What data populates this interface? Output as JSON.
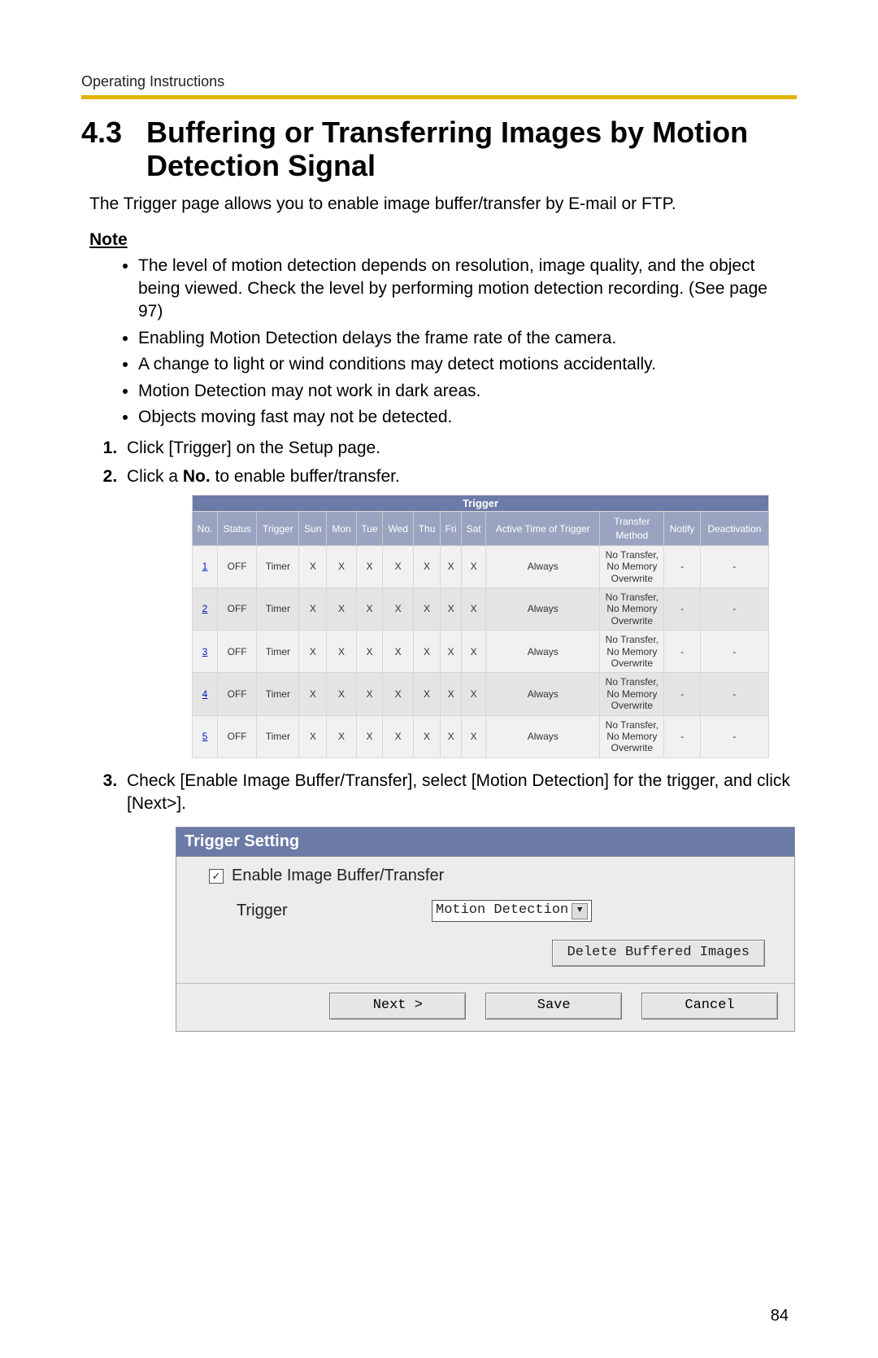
{
  "header": {
    "running": "Operating Instructions"
  },
  "section": {
    "number": "4.3",
    "title": "Buffering or Transferring Images by Motion Detection Signal",
    "intro": "The Trigger page allows you to enable image buffer/transfer by E-mail or FTP."
  },
  "note": {
    "heading": "Note",
    "items": [
      "The level of motion detection depends on resolution, image quality, and the object being viewed. Check the level by performing motion detection recording. (See page 97)",
      "Enabling Motion Detection delays the frame rate of the camera.",
      "A change to light or wind conditions may detect motions accidentally.",
      "Motion Detection may not work in dark areas.",
      "Objects moving fast may not be detected."
    ]
  },
  "steps": {
    "s1": "Click [Trigger] on the Setup page.",
    "s2_pre": "Click a ",
    "s2_bold": "No.",
    "s2_post": " to enable buffer/transfer.",
    "s3": "Check [Enable Image Buffer/Transfer], select [Motion Detection] for the trigger, and click [Next>]."
  },
  "trigger_table": {
    "title": "Trigger",
    "headers": [
      "No.",
      "Status",
      "Trigger",
      "Sun",
      "Mon",
      "Tue",
      "Wed",
      "Thu",
      "Fri",
      "Sat",
      "Active Time of Trigger",
      "Transfer Method",
      "Notify",
      "Deactivation"
    ],
    "transfer_text": "No Transfer, No Memory Overwrite",
    "rows": [
      {
        "no": "1",
        "status": "OFF",
        "trigger": "Timer",
        "d": [
          "X",
          "X",
          "X",
          "X",
          "X",
          "X",
          "X"
        ],
        "active": "Always",
        "notify": "-",
        "deact": "-"
      },
      {
        "no": "2",
        "status": "OFF",
        "trigger": "Timer",
        "d": [
          "X",
          "X",
          "X",
          "X",
          "X",
          "X",
          "X"
        ],
        "active": "Always",
        "notify": "-",
        "deact": "-"
      },
      {
        "no": "3",
        "status": "OFF",
        "trigger": "Timer",
        "d": [
          "X",
          "X",
          "X",
          "X",
          "X",
          "X",
          "X"
        ],
        "active": "Always",
        "notify": "-",
        "deact": "-"
      },
      {
        "no": "4",
        "status": "OFF",
        "trigger": "Timer",
        "d": [
          "X",
          "X",
          "X",
          "X",
          "X",
          "X",
          "X"
        ],
        "active": "Always",
        "notify": "-",
        "deact": "-"
      },
      {
        "no": "5",
        "status": "OFF",
        "trigger": "Timer",
        "d": [
          "X",
          "X",
          "X",
          "X",
          "X",
          "X",
          "X"
        ],
        "active": "Always",
        "notify": "-",
        "deact": "-"
      }
    ]
  },
  "trigger_setting": {
    "title": "Trigger Setting",
    "enable_label": "Enable Image Buffer/Transfer",
    "enable_checked": true,
    "trigger_label": "Trigger",
    "trigger_value": "Motion Detection",
    "delete_btn": "Delete Buffered Images",
    "next_btn": "Next >",
    "save_btn": "Save",
    "cancel_btn": "Cancel"
  },
  "page_number": "84"
}
